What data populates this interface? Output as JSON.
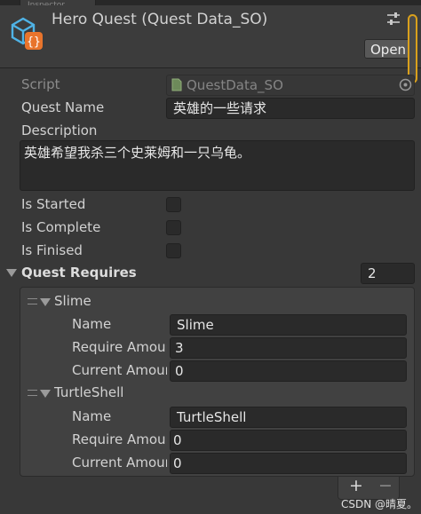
{
  "window": {
    "tab_label": "Inspector",
    "title": "Hero Quest (Quest Data_SO)",
    "open_button": "Open"
  },
  "script_row": {
    "label": "Script",
    "value": "QuestData_SO"
  },
  "quest_name": {
    "label": "Quest Name",
    "value": "英雄的一些请求"
  },
  "description": {
    "label": "Description",
    "value": "英雄希望我杀三个史莱姆和一只乌龟。"
  },
  "flags": [
    {
      "label": "Is Started",
      "checked": false
    },
    {
      "label": "Is Complete",
      "checked": false
    },
    {
      "label": "Is Finised",
      "checked": false
    }
  ],
  "requires": {
    "label": "Quest Requires",
    "count": "2",
    "items": [
      {
        "title": "Slime",
        "name_label": "Name",
        "name_value": "Slime",
        "require_label": "Require Amour",
        "require_value": "3",
        "current_label": "Current Amour",
        "current_value": "0"
      },
      {
        "title": "TurtleShell",
        "name_label": "Name",
        "name_value": "TurtleShell",
        "require_label": "Require Amour",
        "require_value": "0",
        "current_label": "Current Amour",
        "current_value": "0"
      }
    ],
    "add_label": "+",
    "remove_label": "−"
  },
  "watermark": "CSDN @晴夏。",
  "colors": {
    "background": "#383838",
    "field": "#2a2a2a",
    "icon_blue": "#4fb3e6",
    "icon_orange": "#e8742c",
    "scroll_highlight": "#d9a01c"
  }
}
